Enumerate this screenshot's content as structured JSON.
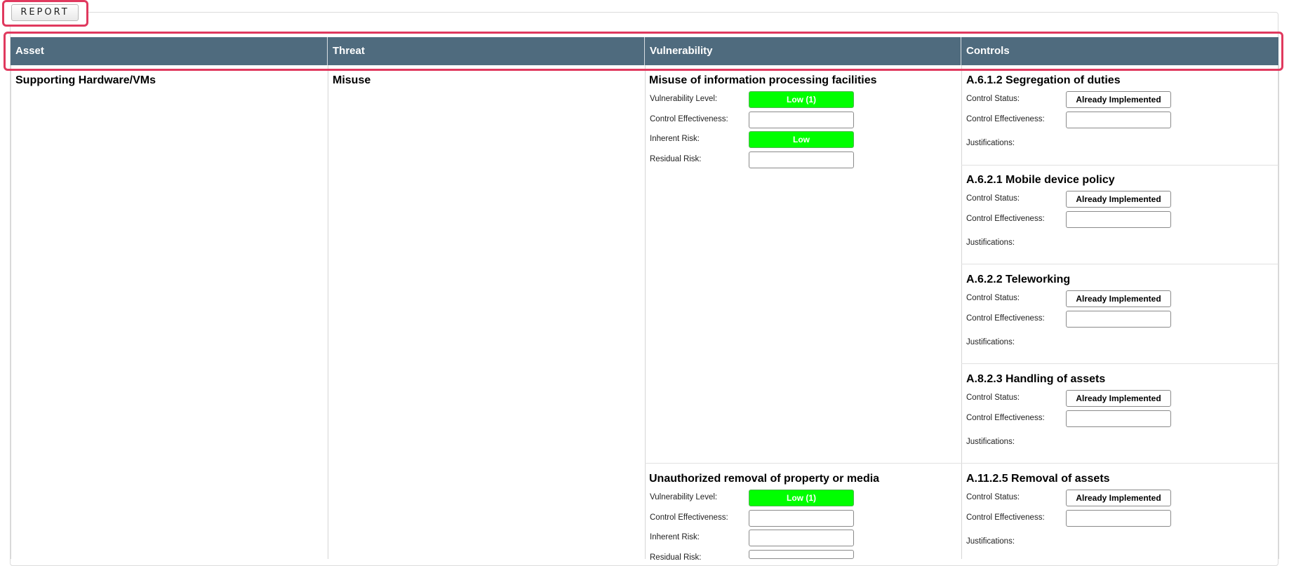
{
  "report_button": "REPORT",
  "columns": [
    "Asset",
    "Threat",
    "Vulnerability",
    "Controls"
  ],
  "asset": "Supporting Hardware/VMs",
  "threat": "Misuse",
  "vulnerabilities": [
    {
      "title": "Misuse of information processing facilities",
      "level_label": "Vulnerability Level:",
      "level_value": "Low (1)",
      "control_eff_label": "Control Effectiveness:",
      "control_eff_value": "",
      "inherent_label": "Inherent Risk:",
      "inherent_value": "Low",
      "residual_label": "Residual Risk:",
      "residual_value": ""
    },
    {
      "title": "Unauthorized removal of property or media",
      "level_label": "Vulnerability Level:",
      "level_value": "Low (1)",
      "control_eff_label": "Control Effectiveness:",
      "control_eff_value": "",
      "inherent_label": "Inherent Risk:",
      "inherent_value": "",
      "residual_label": "Residual Risk:",
      "residual_value": ""
    }
  ],
  "controls": [
    {
      "title": "A.6.1.2 Segregation of duties",
      "status_label": "Control Status:",
      "status_value": "Already Implemented",
      "eff_label": "Control Effectiveness:",
      "eff_value": "",
      "just_label": "Justifications:"
    },
    {
      "title": "A.6.2.1 Mobile device policy",
      "status_label": "Control Status:",
      "status_value": "Already Implemented",
      "eff_label": "Control Effectiveness:",
      "eff_value": "",
      "just_label": "Justifications:"
    },
    {
      "title": "A.6.2.2 Teleworking",
      "status_label": "Control Status:",
      "status_value": "Already Implemented",
      "eff_label": "Control Effectiveness:",
      "eff_value": "",
      "just_label": "Justifications:"
    },
    {
      "title": "A.8.2.3 Handling of assets",
      "status_label": "Control Status:",
      "status_value": "Already Implemented",
      "eff_label": "Control Effectiveness:",
      "eff_value": "",
      "just_label": "Justifications:"
    },
    {
      "title": "A.11.2.5 Removal of assets",
      "status_label": "Control Status:",
      "status_value": "Already Implemented",
      "eff_label": "Control Effectiveness:",
      "eff_value": "",
      "just_label": "Justifications:"
    }
  ],
  "colors": {
    "header_bg": "#4f6b7e",
    "risk_low": "#00ff00",
    "highlight": "#e0395e"
  }
}
